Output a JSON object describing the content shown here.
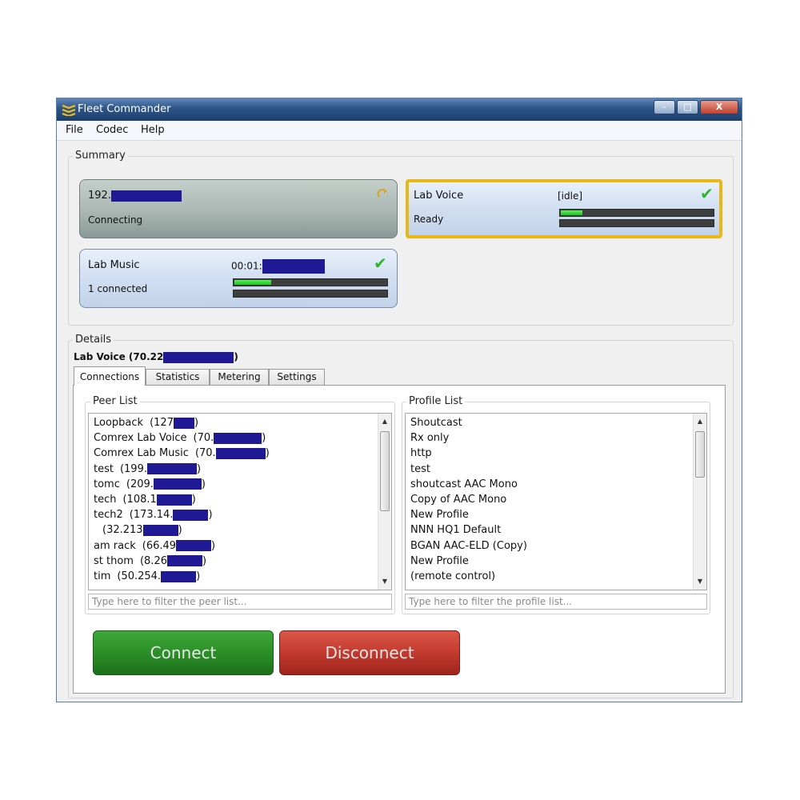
{
  "window": {
    "title": "Fleet Commander",
    "controls": {
      "minimize": "–",
      "maximize": "□",
      "close": "X"
    }
  },
  "menu": {
    "items": [
      "File",
      "Codec",
      "Help"
    ]
  },
  "summary": {
    "label": "Summary",
    "cards": [
      {
        "name": "192.",
        "status": "Connecting",
        "state": "connecting"
      },
      {
        "name": "Lab Voice",
        "time": "[idle]",
        "status": "Ready",
        "meter_level": 0.14,
        "selected": true
      },
      {
        "name": "Lab Music",
        "time": "00:01:",
        "status": "1 connected",
        "meter_level": 0.24
      }
    ]
  },
  "details": {
    "label": "Details",
    "selected_title": "Lab Voice (70.22",
    "selected_title_suffix": ")",
    "tabs": [
      "Connections",
      "Statistics",
      "Metering",
      "Settings"
    ],
    "active_tab": "Connections",
    "peer_list": {
      "label": "Peer List",
      "items": [
        {
          "name": "Loopback",
          "addr": "(127"
        },
        {
          "name": "Comrex Lab Voice",
          "addr": "(70."
        },
        {
          "name": "Comrex Lab Music",
          "addr": "(70."
        },
        {
          "name": "test",
          "addr": "(199."
        },
        {
          "name": "tomc",
          "addr": "(209."
        },
        {
          "name": "tech",
          "addr": "(108.1"
        },
        {
          "name": "tech2",
          "addr": "(173.14."
        },
        {
          "name": "",
          "addr": "(32.213"
        },
        {
          "name": "am rack",
          "addr": "(66.49"
        },
        {
          "name": "st thom",
          "addr": "(8.26"
        },
        {
          "name": "tim",
          "addr": "(50.254."
        }
      ],
      "closing_paren": ")",
      "filter_placeholder": "Type here to filter the peer list..."
    },
    "profile_list": {
      "label": "Profile List",
      "items": [
        "Shoutcast",
        "Rx only",
        "http",
        "test",
        "shoutcast AAC Mono",
        "Copy of AAC Mono",
        "New Profile",
        "NNN HQ1 Default",
        "BGAN AAC-ELD (Copy)",
        "New Profile",
        "(remote control)"
      ],
      "filter_placeholder": "Type here to filter the profile list..."
    },
    "buttons": {
      "connect": "Connect",
      "disconnect": "Disconnect"
    }
  },
  "colors": {
    "title_bar": "#2d5487",
    "selected_outline": "#e6b916",
    "meter_green": "#1fc21f",
    "check_green": "#2db52d",
    "connect_green": "#2b8f27",
    "disconnect_red": "#c43a2e",
    "redaction": "#1f1a94"
  }
}
